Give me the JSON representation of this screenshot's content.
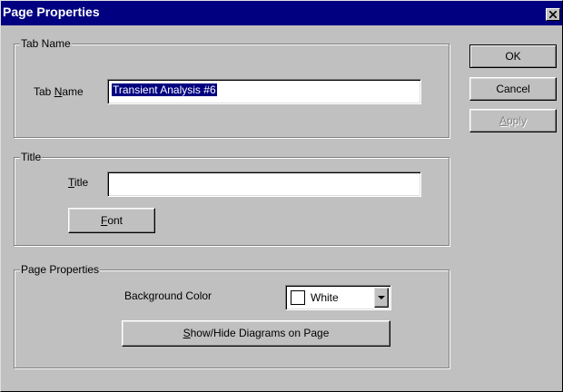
{
  "window": {
    "title": "Page Properties"
  },
  "tab_name_group": {
    "legend": "Tab Name",
    "label_pre": "Tab ",
    "label_accel": "N",
    "label_post": "ame",
    "value": "Transient Analysis #6"
  },
  "title_group": {
    "legend": "Title",
    "label_accel": "T",
    "label_post": "itle",
    "value": "",
    "font_accel": "F",
    "font_post": "ont"
  },
  "page_props_group": {
    "legend": "Page Properties",
    "bg_label": "Background Color",
    "bg_value": "White",
    "bg_color": "#ffffff",
    "showhide_accel": "S",
    "showhide_post": "how/Hide Diagrams on Page"
  },
  "buttons": {
    "ok": "OK",
    "cancel": "Cancel",
    "apply_accel": "A",
    "apply_post": "pply"
  },
  "icons": {
    "close": "close-icon",
    "dropdown": "chevron-down-icon"
  },
  "colors": {
    "titlebar": "#000080",
    "face": "#c0c0c0",
    "selection": "#000080"
  }
}
